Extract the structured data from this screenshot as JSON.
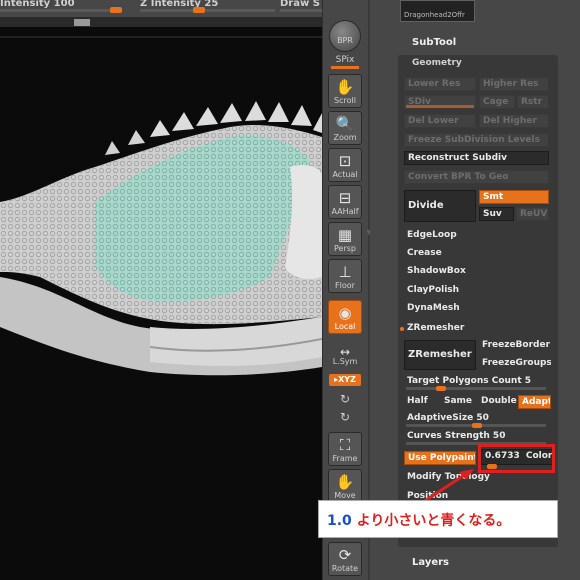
{
  "topbar": {
    "intensity": "Intensity 100",
    "z_intensity": "Z Intensity 25",
    "draw": "Draw S"
  },
  "shelf": {
    "bpr": "BPR",
    "spix": "SPix",
    "scroll": "Scroll",
    "zoom": "Zoom",
    "actual": "Actual",
    "aahalf": "AAHalf",
    "persp": "Persp",
    "floor": "Floor",
    "local": "Local",
    "lsym": "L.Sym",
    "xyz": "▸XYZ",
    "frame": "Frame",
    "move": "Move",
    "rotate": "Rotate"
  },
  "panel": {
    "thumb_label": "Dragonhead2Offr",
    "subtool": "SubTool",
    "geometry": "Geometry",
    "lower_res": "Lower Res",
    "higher_res": "Higher Res",
    "sdiv": "SDiv",
    "cage": "Cage",
    "rstr": "Rstr",
    "del_lower": "Del Lower",
    "del_higher": "Del Higher",
    "freeze_subdiv": "Freeze SubDivision Levels",
    "reconstruct_subdiv": "Reconstruct Subdiv",
    "convert_bpr": "Convert BPR To Geo",
    "divide": "Divide",
    "smt": "Smt",
    "suv": "Suv",
    "reuv": "ReUV",
    "edgeloop": "EdgeLoop",
    "crease": "Crease",
    "shadowbox": "ShadowBox",
    "claypolish": "ClayPolish",
    "dynamesh": "DynaMesh",
    "zremesher_header": "ZRemesher",
    "zremesher_btn": "ZRemesher",
    "freeze_border": "FreezeBorder",
    "freeze_groups": "FreezeGroups",
    "target_polygons": "Target Polygons Count 5",
    "half": "Half",
    "same": "Same",
    "double": "Double",
    "adapt": "Adapt",
    "adaptive_size": "AdaptiveSize 50",
    "curves_strength": "Curves Strength 50",
    "use_polypaint": "Use Polypaint",
    "color_value": "0.6733",
    "color_label": "Color",
    "modify_topology": "Modify Topology",
    "position": "Position",
    "layers": "Layers"
  },
  "annotation": {
    "number": "1.0",
    "text": " より小さいと青くなる。"
  },
  "colors": {
    "accent_orange": "#e8721c",
    "annotation_red": "#e0201c",
    "annotation_blue": "#1a4fc9",
    "mesh_cyan": "#a8d8cc"
  }
}
